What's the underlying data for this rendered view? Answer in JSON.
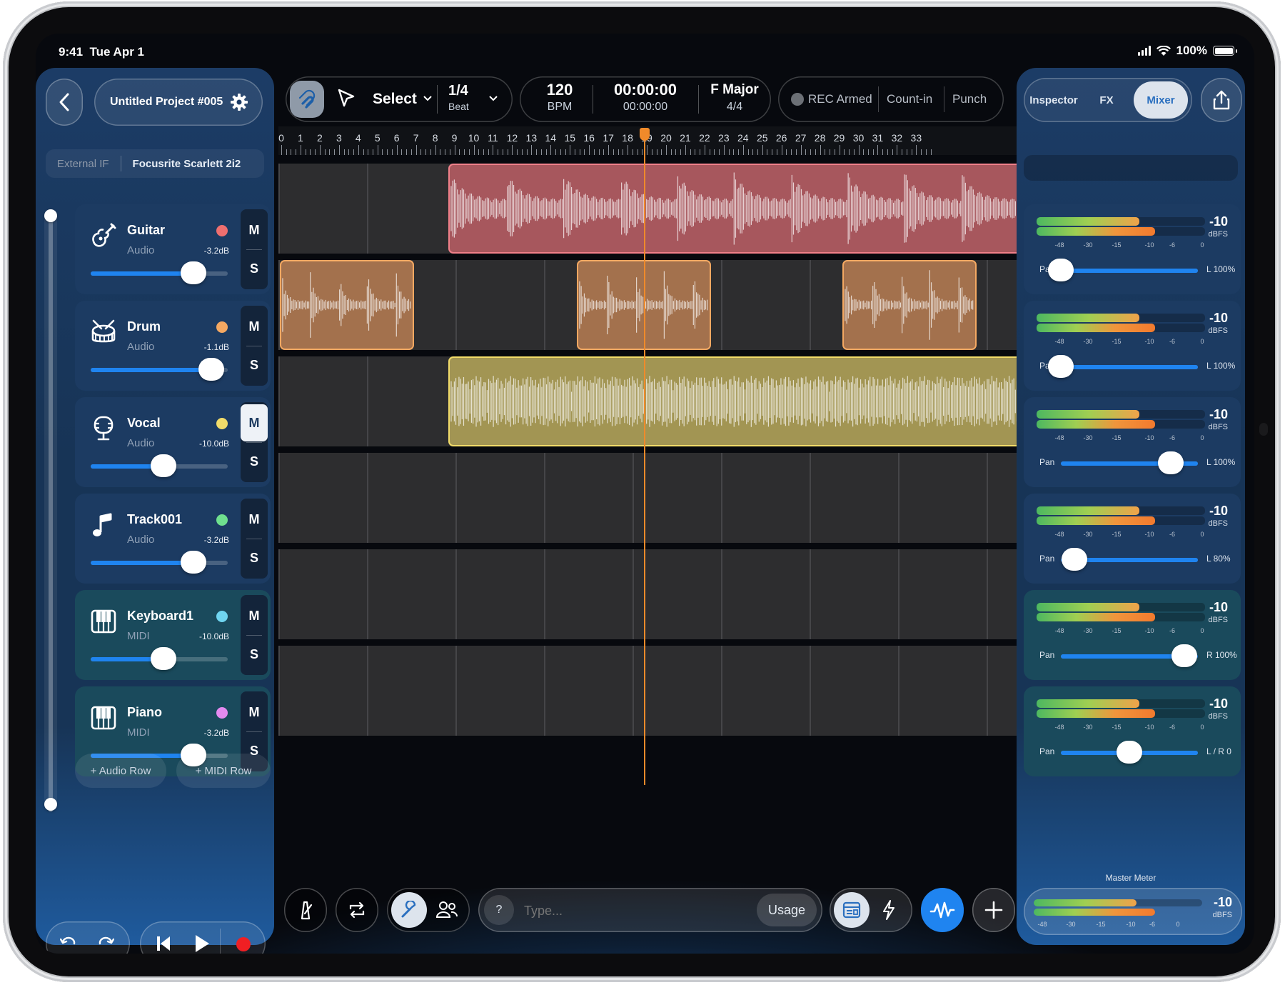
{
  "status": {
    "time": "9:41",
    "date": "Tue Apr 1",
    "battery": "100%"
  },
  "project": {
    "name": "Untitled Project #005"
  },
  "interface": {
    "label": "External IF",
    "device": "Focusrite Scarlett 2i2"
  },
  "tools": {
    "mode": "Select",
    "quantize": "1/4",
    "quantize_unit": "Beat"
  },
  "transport": {
    "tempo": "120",
    "tempo_unit": "BPM",
    "time_primary": "00:00:00",
    "time_secondary": "00:00:00",
    "key": "F Major",
    "signature": "4/4"
  },
  "record": {
    "armed_label": "REC Armed",
    "countin_label": "Count-in",
    "punch_label": "Punch"
  },
  "right_tabs": {
    "inspector": "Inspector",
    "fx": "FX",
    "mixer": "Mixer",
    "active": "Mixer"
  },
  "ruler": {
    "bars": [
      "0",
      "1",
      "2",
      "3",
      "4",
      "5",
      "6",
      "7",
      "8",
      "9",
      "10",
      "11",
      "12",
      "13",
      "14",
      "15",
      "16",
      "17",
      "18",
      "19",
      "20",
      "21",
      "22",
      "23",
      "24",
      "25",
      "26",
      "27",
      "28",
      "29",
      "30",
      "31",
      "32",
      "33"
    ]
  },
  "tracks": [
    {
      "name": "Guitar",
      "type": "Audio",
      "gain": "-3.2dB",
      "volume": 0.75,
      "color": "#ef6f6f",
      "icon": "guitar-icon",
      "mute_on": false,
      "pan_value": "L 100%",
      "pan": 0.0,
      "meter": "-10",
      "meter_unit": "dBFS"
    },
    {
      "name": "Drum",
      "type": "Audio",
      "gain": "-1.1dB",
      "volume": 0.88,
      "color": "#f4a862",
      "icon": "drum-icon",
      "mute_on": false,
      "pan_value": "L 100%",
      "pan": 0.0,
      "meter": "-10",
      "meter_unit": "dBFS"
    },
    {
      "name": "Vocal",
      "type": "Audio",
      "gain": "-10.0dB",
      "volume": 0.53,
      "color": "#f2dc6a",
      "icon": "microphone-icon",
      "mute_on": true,
      "pan_value": "L 100%",
      "pan": 0.8,
      "meter": "-10",
      "meter_unit": "dBFS"
    },
    {
      "name": "Track001",
      "type": "Audio",
      "gain": "-3.2dB",
      "volume": 0.75,
      "color": "#6fe08e",
      "icon": "music-note-icon",
      "mute_on": false,
      "pan_value": "L 80%",
      "pan": 0.1,
      "meter": "-10",
      "meter_unit": "dBFS"
    },
    {
      "name": "Keyboard1",
      "type": "MIDI",
      "gain": "-10.0dB",
      "volume": 0.53,
      "color": "#6fd5f0",
      "icon": "keyboard-icon",
      "mute_on": false,
      "pan_value": "R 100%",
      "pan": 0.9,
      "meter": "-10",
      "meter_unit": "dBFS"
    },
    {
      "name": "Piano",
      "type": "MIDI",
      "gain": "-3.2dB",
      "volume": 0.75,
      "color": "#e48af0",
      "icon": "piano-icon",
      "mute_on": false,
      "pan_value": "L / R 0",
      "pan": 0.5,
      "meter": "-10",
      "meter_unit": "dBFS"
    }
  ],
  "meter_scale": [
    "-48",
    "-30",
    "-15",
    "-10",
    "-6",
    "0"
  ],
  "pan_label": "Pan",
  "buttons": {
    "s": "S",
    "m": "M",
    "add_audio": "+ Audio Row",
    "add_midi": "+ MIDI Row",
    "usage": "Usage",
    "help": "?"
  },
  "command": {
    "placeholder": "Type..."
  },
  "master": {
    "label": "Master Meter",
    "value": "-10",
    "unit": "dBFS"
  },
  "colors": {
    "accent": "#1f84f0",
    "playhead": "#f08a2a",
    "guitar_clip": "#a7575d",
    "drum_clip": "#a3714d",
    "vocal_clip": "#a29553"
  }
}
